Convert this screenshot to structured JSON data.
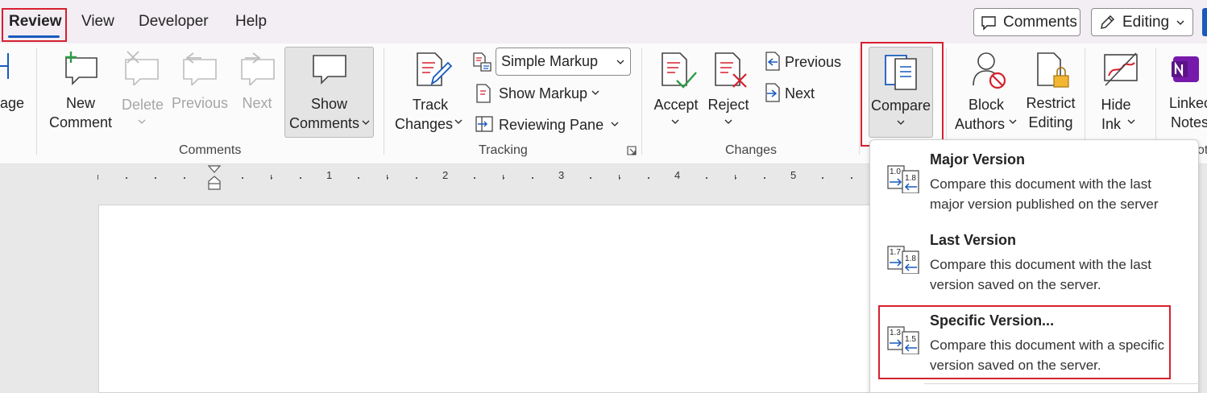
{
  "tabs": [
    "Review",
    "View",
    "Developer",
    "Help"
  ],
  "top_buttons": {
    "comments": "Comments",
    "editing": "Editing"
  },
  "ribbon": {
    "partial_left": "age",
    "comments_group": {
      "label": "Comments",
      "new_comment": [
        "New",
        "Comment"
      ],
      "delete": "Delete",
      "previous": "Previous",
      "next": "Next",
      "show_comments": [
        "Show",
        "Comments"
      ]
    },
    "tracking_group": {
      "label": "Tracking",
      "track_changes": [
        "Track",
        "Changes"
      ],
      "markup_select": "Simple Markup",
      "show_markup": "Show Markup",
      "reviewing_pane": "Reviewing Pane"
    },
    "changes_group": {
      "label": "Changes",
      "accept": "Accept",
      "reject": "Reject",
      "previous": "Previous",
      "next": "Next"
    },
    "compare": "Compare",
    "block_authors": [
      "Block",
      "Authors"
    ],
    "restrict_editing": [
      "Restrict",
      "Editing"
    ],
    "hide_ink": [
      "Hide",
      "Ink"
    ],
    "linked_notes": [
      "Linkec",
      "Notes"
    ],
    "partial_right_label": "ot"
  },
  "ruler_numbers": [
    "1",
    "2",
    "3",
    "4",
    "5"
  ],
  "compare_menu": [
    {
      "title": "Major Version",
      "desc": "Compare this document with the last major version published on the server",
      "from": "1.0",
      "to": "1.8"
    },
    {
      "title": "Last Version",
      "desc": "Compare this document with the last version saved on the server.",
      "from": "1.7",
      "to": "1.8"
    },
    {
      "title": "Specific Version...",
      "desc": "Compare this document with a specific version saved on the server.",
      "from": "1.3",
      "to": "1.5"
    }
  ],
  "colors": {
    "accent": "#185abd",
    "highlight": "#d6202f",
    "onenote": "#7719aa"
  }
}
